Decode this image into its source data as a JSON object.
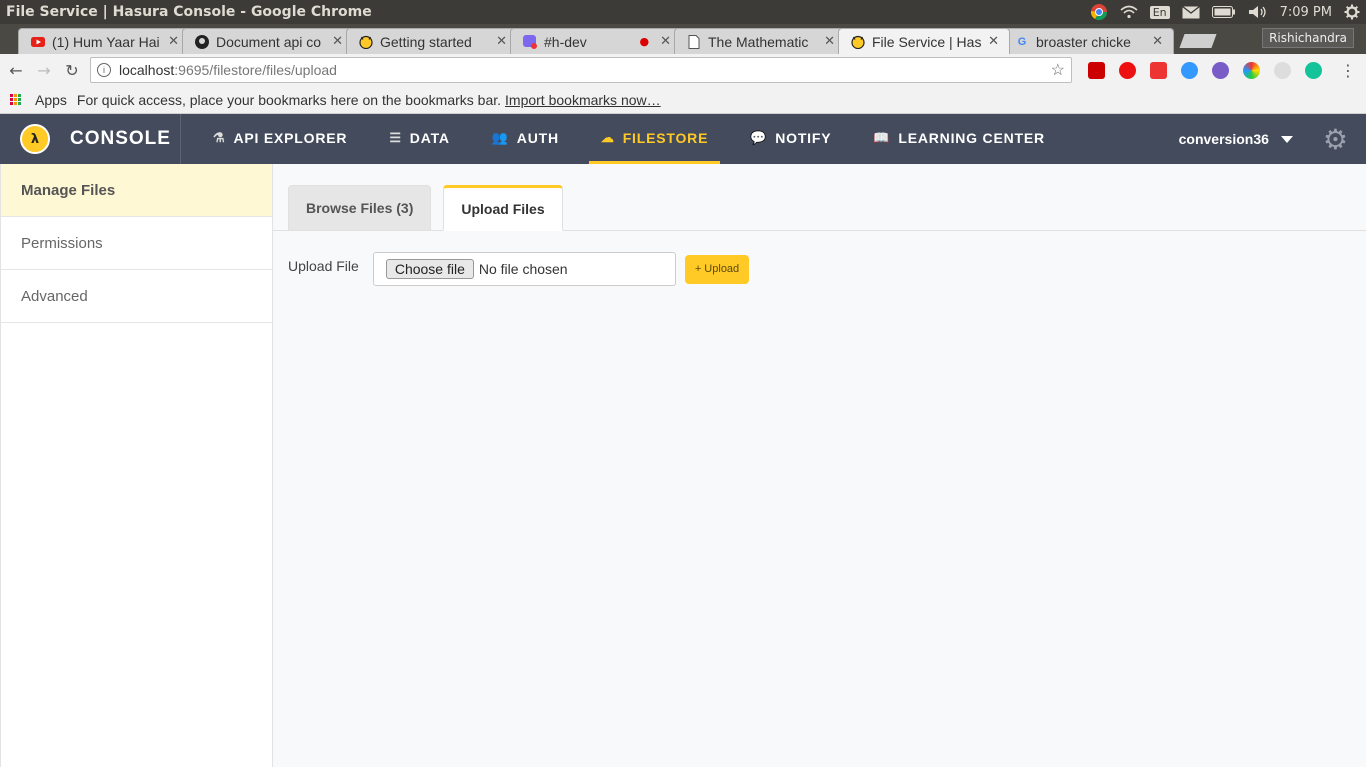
{
  "os": {
    "window_title": "File Service | Hasura Console - Google Chrome",
    "lang": "En",
    "time": "7:09 PM"
  },
  "browser": {
    "tabs": [
      {
        "title": "(1) Hum Yaar Hai",
        "favicon": "youtube-icon"
      },
      {
        "title": "Document api co",
        "favicon": "github-icon"
      },
      {
        "title": "Getting started",
        "favicon": "hasura-icon"
      },
      {
        "title": "#h-dev",
        "favicon": "chat-icon",
        "recording": true
      },
      {
        "title": "The Mathematic",
        "favicon": "page-icon"
      },
      {
        "title": "File Service | Has",
        "favicon": "hasura-icon",
        "active": true
      },
      {
        "title": "broaster chicke",
        "favicon": "google-icon"
      }
    ],
    "profile": "Rishichandra",
    "url_host": "localhost",
    "url_path": ":9695/filestore/files/upload",
    "bookmarks_apps": "Apps",
    "bookmarks_hint": "For quick access, place your bookmarks here on the bookmarks bar.",
    "bookmarks_import": "Import bookmarks now…"
  },
  "console": {
    "brand": "CONSOLE",
    "nav": [
      {
        "label": "API EXPLORER",
        "icon": "flask-icon"
      },
      {
        "label": "DATA",
        "icon": "database-icon"
      },
      {
        "label": "AUTH",
        "icon": "users-icon"
      },
      {
        "label": "FILESTORE",
        "icon": "cloud-upload-icon",
        "active": true
      },
      {
        "label": "NOTIFY",
        "icon": "chat-bubble-icon"
      },
      {
        "label": "LEARNING CENTER",
        "icon": "book-icon"
      }
    ],
    "project": "conversion36",
    "accent": "#ffc926",
    "nav_bg": "#444b5c"
  },
  "sidebar": {
    "items": [
      {
        "label": "Manage Files",
        "active": true
      },
      {
        "label": "Permissions"
      },
      {
        "label": "Advanced"
      }
    ]
  },
  "content": {
    "tabs": [
      {
        "label": "Browse Files (3)"
      },
      {
        "label": "Upload Files",
        "active": true
      }
    ],
    "upload_label": "Upload File",
    "choose_button": "Choose file",
    "no_file": "No file chosen",
    "upload_button": "+ Upload"
  }
}
